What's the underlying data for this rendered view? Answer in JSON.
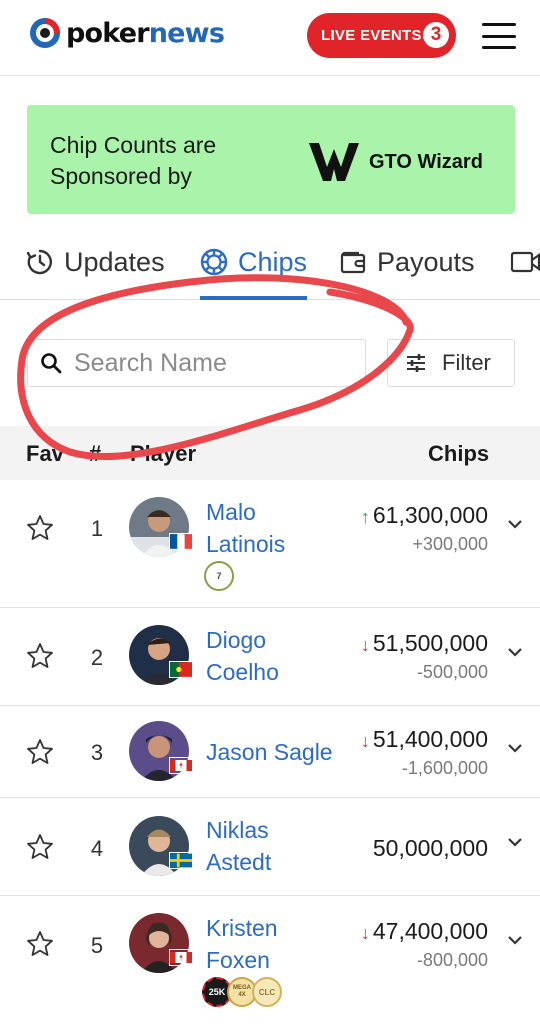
{
  "header": {
    "brand_part1": "poker",
    "brand_part2": "news",
    "live_label": "LIVE EVENTS",
    "live_count": "3",
    "logo_icon": "pokernews-chip-logo",
    "menu_icon": "hamburger-menu-icon"
  },
  "sponsor": {
    "text": "Chip Counts are Sponsored by",
    "partner_name": "GTO Wizard",
    "bg_color": "#a9f3ab"
  },
  "tabs": [
    {
      "label": "Updates",
      "icon": "clock-icon",
      "active": false
    },
    {
      "label": "Chips",
      "icon": "chip-icon",
      "active": true
    },
    {
      "label": "Payouts",
      "icon": "wallet-icon",
      "active": false
    }
  ],
  "search": {
    "placeholder": "Search Name"
  },
  "filter": {
    "label": "Filter"
  },
  "table": {
    "col_fav": "Fav",
    "col_rank": "#",
    "col_player": "Player",
    "col_chips": "Chips"
  },
  "players": [
    {
      "rank": "1",
      "name_line1": "Malo",
      "name_line2": "Latinois",
      "chips": "61,300,000",
      "change": "+300,000",
      "trend": "up",
      "flag": "France",
      "badges": [
        "7"
      ]
    },
    {
      "rank": "2",
      "name_line1": "Diogo",
      "name_line2": "Coelho",
      "chips": "51,500,000",
      "change": "-500,000",
      "trend": "down",
      "flag": "Portugal",
      "badges": []
    },
    {
      "rank": "3",
      "name_line1": "Jason Sagle",
      "name_line2": "",
      "chips": "51,400,000",
      "change": "-1,600,000",
      "trend": "down",
      "flag": "Canada",
      "badges": []
    },
    {
      "rank": "4",
      "name_line1": "Niklas",
      "name_line2": "Astedt",
      "chips": "50,000,000",
      "change": "",
      "trend": "none",
      "flag": "Sweden",
      "badges": []
    },
    {
      "rank": "5",
      "name_line1": "Kristen",
      "name_line2": "Foxen",
      "chips": "47,400,000",
      "change": "-800,000",
      "trend": "down",
      "flag": "Canada",
      "badges": [
        "25K",
        "MEGA 4X",
        "CLC"
      ]
    }
  ],
  "colors": {
    "accent": "#2c6bc4",
    "live_red": "#e0242a",
    "up_green": "#21a04a",
    "annotation_red": "#e8474c"
  }
}
